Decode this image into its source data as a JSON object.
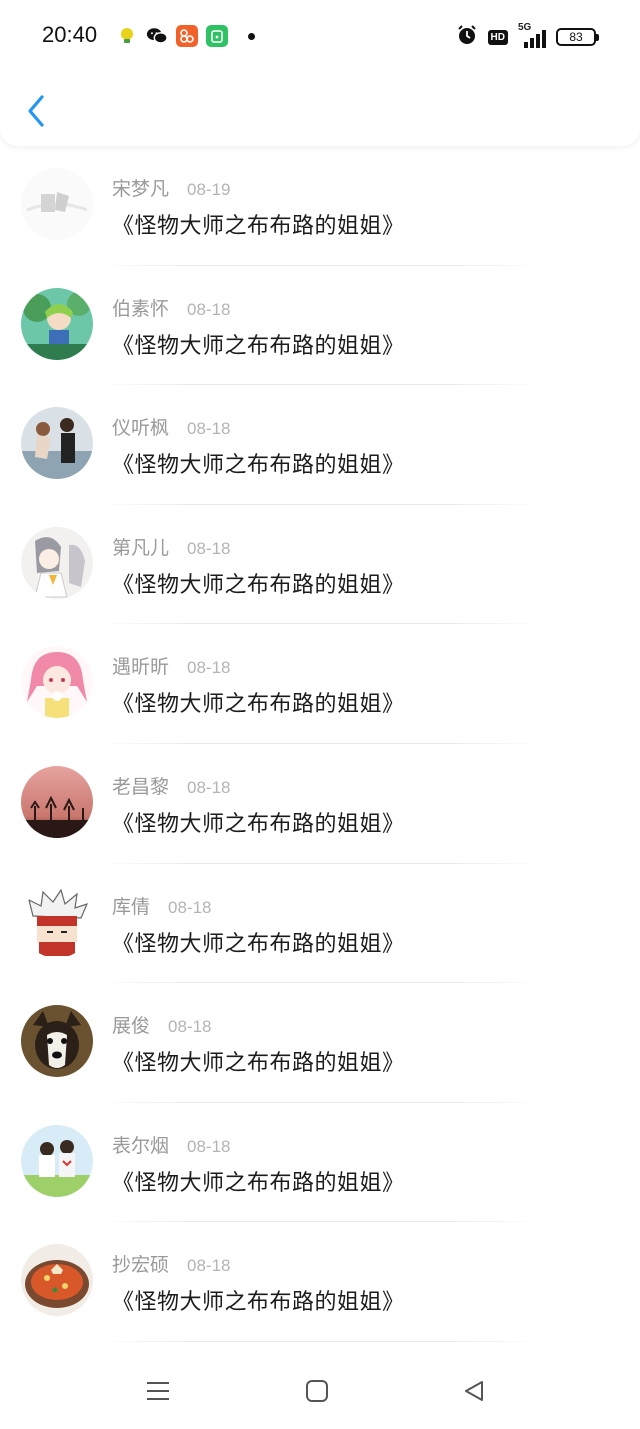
{
  "status_bar": {
    "time": "20:40",
    "network": "5G",
    "hd": "HD",
    "battery": "83"
  },
  "header": {
    "back_icon": "chevron-left-icon"
  },
  "items": [
    {
      "name": "宋梦凡",
      "date": "08-19",
      "title": "《怪物大师之布布路的姐姐》"
    },
    {
      "name": "伯素怀",
      "date": "08-18",
      "title": "《怪物大师之布布路的姐姐》"
    },
    {
      "name": "仪听枫",
      "date": "08-18",
      "title": "《怪物大师之布布路的姐姐》"
    },
    {
      "name": "第凡儿",
      "date": "08-18",
      "title": "《怪物大师之布布路的姐姐》"
    },
    {
      "name": "遇昕昕",
      "date": "08-18",
      "title": "《怪物大师之布布路的姐姐》"
    },
    {
      "name": "老昌黎",
      "date": "08-18",
      "title": "《怪物大师之布布路的姐姐》"
    },
    {
      "name": "库倩",
      "date": "08-18",
      "title": "《怪物大师之布布路的姐姐》"
    },
    {
      "name": "展俊",
      "date": "08-18",
      "title": "《怪物大师之布布路的姐姐》"
    },
    {
      "name": "表尔烟",
      "date": "08-18",
      "title": "《怪物大师之布布路的姐姐》"
    },
    {
      "name": "抄宏硕",
      "date": "08-18",
      "title": "《怪物大师之布布路的姐姐》"
    }
  ],
  "colors": {
    "accent": "#2196f3",
    "name_text": "#9a9a9a",
    "date_text": "#b4b4b4",
    "title_text": "#1c1c1c"
  },
  "nav_bar": {
    "icons": [
      "menu-icon",
      "home-square-icon",
      "back-triangle-icon"
    ]
  }
}
